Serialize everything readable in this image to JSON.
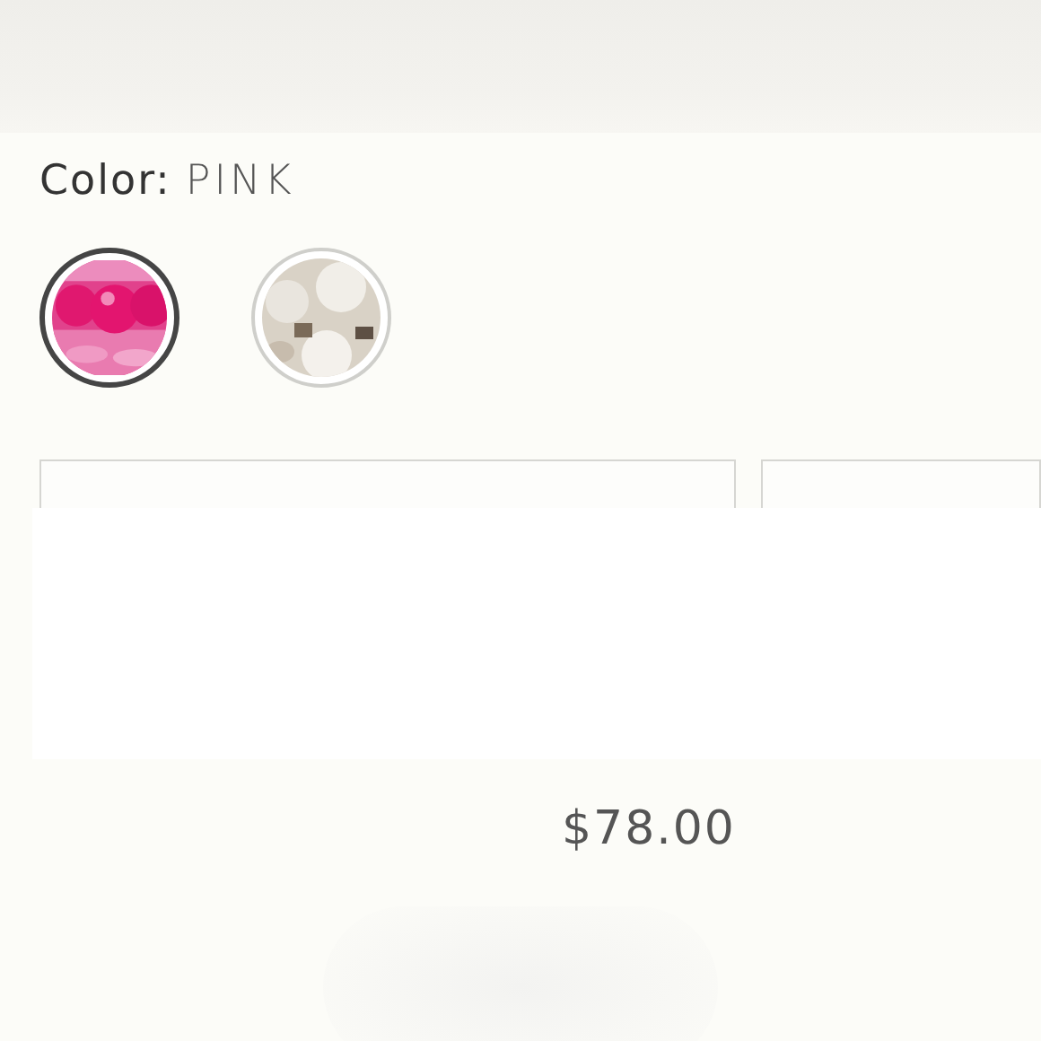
{
  "color_selector": {
    "label": "Color:",
    "value": "PINK",
    "swatches": [
      {
        "kind": "picture",
        "selected": true
      },
      {
        "kind": "picture",
        "selected": false
      }
    ]
  },
  "price": "$78.00"
}
